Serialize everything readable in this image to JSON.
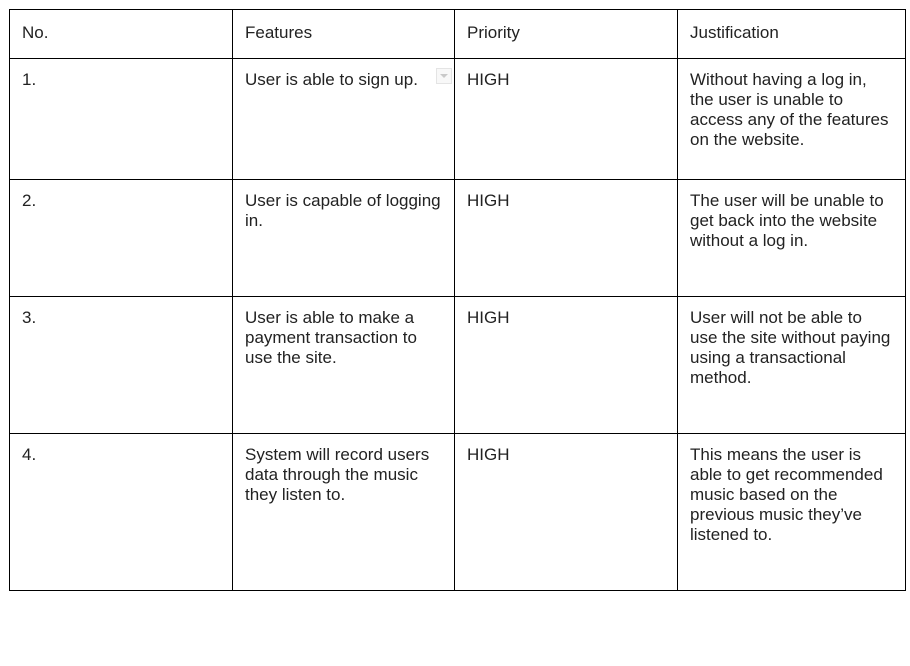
{
  "table": {
    "headers": {
      "no": "No.",
      "features": "Features",
      "priority": "Priority",
      "justification": "Justification"
    },
    "rows": [
      {
        "no": "1.",
        "feature": "User is able to sign up.",
        "priority": "HIGH",
        "justification": "Without having a log in, the user is unable to access any of the features on the website."
      },
      {
        "no": "2.",
        "feature": "User is capable of logging in.",
        "priority": "HIGH",
        "justification": "The user will be unable to get back into the website without a log in."
      },
      {
        "no": "3.",
        "feature": "User is able to make a payment transaction to use the site.",
        "priority": "HIGH",
        "justification": "User will not be able to use the site without paying using a transactional method."
      },
      {
        "no": "4.",
        "feature": "System will record users data through the music they listen to.",
        "priority": "HIGH",
        "justification": "This means the user is able to get recommended music based on the previous music they’ve listened to."
      }
    ]
  },
  "icons": {
    "cell_dropdown": "chevron-down-icon"
  },
  "colors": {
    "border": "#000000",
    "text": "#222222",
    "background": "#ffffff"
  }
}
